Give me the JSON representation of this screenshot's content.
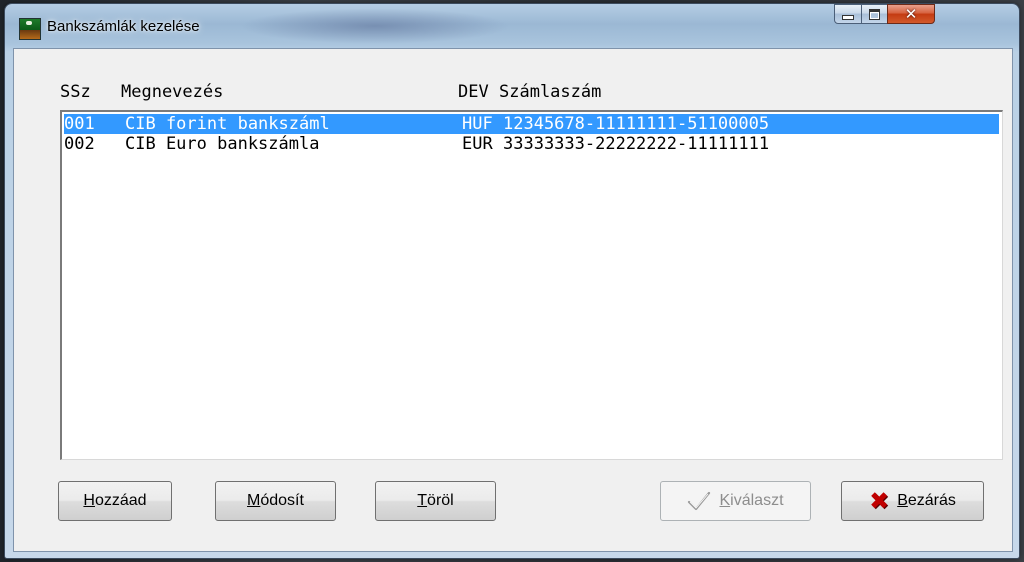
{
  "window": {
    "title": "Bankszámlák kezelése"
  },
  "columns": {
    "ssz": "SSz",
    "megnevezes": "Megnevezés",
    "dev": "DEV",
    "szamlaszam": "Számlaszám"
  },
  "rows": [
    {
      "ssz": "001",
      "name": "CIB forint bankszáml",
      "dev": "HUF",
      "account": "12345678-11111111-51100005",
      "selected": true
    },
    {
      "ssz": "002",
      "name": "CIB Euro bankszámla",
      "dev": "EUR",
      "account": "33333333-22222222-11111111",
      "selected": false
    }
  ],
  "buttons": {
    "add": {
      "hotkey": "H",
      "rest": "ozzáad"
    },
    "modify": {
      "hotkey": "M",
      "rest": "ódosít"
    },
    "delete": {
      "hotkey": "T",
      "rest": "öröl"
    },
    "select": {
      "hotkey": "K",
      "rest": "iválaszt",
      "enabled": false,
      "icon": "checkmark-icon"
    },
    "close": {
      "hotkey": "B",
      "rest": "ezárás",
      "icon": "red-x-icon"
    }
  },
  "colors": {
    "selection": "#3399ff",
    "close_icon": "#c00000"
  }
}
